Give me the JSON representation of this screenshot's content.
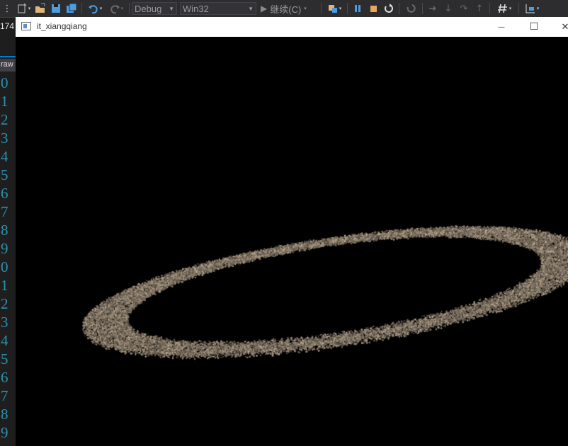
{
  "toolbar": {
    "configuration": "Debug",
    "platform": "Win32",
    "continue_label": "继续(C)"
  },
  "editor": {
    "tab_number": "174",
    "tab_label": "raw",
    "line_numbers": [
      "0",
      "1",
      "2",
      "3",
      "4",
      "5",
      "6",
      "7",
      "8",
      "9",
      "0",
      "1",
      "2",
      "3",
      "4",
      "5",
      "6",
      "7",
      "8",
      "9"
    ]
  },
  "window": {
    "title": "it_xiangqiang",
    "minimize": "—",
    "maximize": "☐",
    "close": "✕"
  },
  "scene": {
    "background": "#000000",
    "particle_color": "#8a7a6a",
    "description_shape": "ring"
  }
}
